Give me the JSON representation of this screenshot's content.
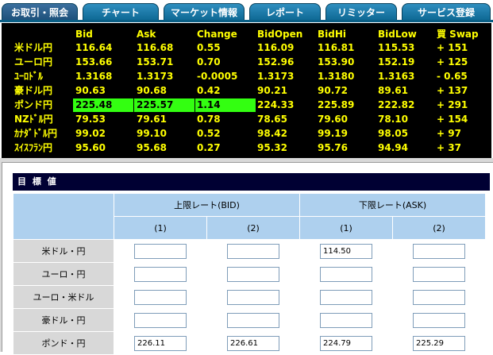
{
  "tabs": [
    {
      "label": "お取引・照会"
    },
    {
      "label": "チャート"
    },
    {
      "label": "マーケット情報"
    },
    {
      "label": "レポート"
    },
    {
      "label": "リミッター"
    },
    {
      "label": "サービス登録"
    }
  ],
  "board": {
    "columns": [
      "Bid",
      "Ask",
      "Change",
      "BidOpen",
      "BidHi",
      "BidLow",
      "買 Swap"
    ],
    "rows": [
      {
        "pair": "米ドル円",
        "bid": "116.64",
        "ask": "116.68",
        "change": "0.55",
        "open": "116.09",
        "hi": "116.81",
        "low": "115.53",
        "swap": "+ 151"
      },
      {
        "pair": "ユーロ円",
        "bid": "153.66",
        "ask": "153.71",
        "change": "0.70",
        "open": "152.96",
        "hi": "153.90",
        "low": "152.19",
        "swap": "+ 125"
      },
      {
        "pair": "ﾕｰﾛﾄﾞﾙ",
        "bid": "1.3168",
        "ask": "1.3173",
        "change": "-0.0005",
        "open": "1.3173",
        "hi": "1.3180",
        "low": "1.3163",
        "swap": "- 0.65"
      },
      {
        "pair": "豪ドル円",
        "bid": "90.63",
        "ask": "90.68",
        "change": "0.42",
        "open": "90.21",
        "hi": "90.72",
        "low": "89.61",
        "swap": "+ 137"
      },
      {
        "pair": "ポンド円",
        "bid": "225.48",
        "ask": "225.57",
        "change": "1.14",
        "open": "224.33",
        "hi": "225.89",
        "low": "222.82",
        "swap": "+ 291"
      },
      {
        "pair": "NZﾄﾞﾙ円",
        "bid": "79.53",
        "ask": "79.61",
        "change": "0.78",
        "open": "78.65",
        "hi": "79.60",
        "low": "78.10",
        "swap": "+ 154"
      },
      {
        "pair": "ｶﾅﾀﾞﾄﾞﾙ円",
        "bid": "99.02",
        "ask": "99.10",
        "change": "0.52",
        "open": "98.42",
        "hi": "99.19",
        "low": "98.05",
        "swap": "+ 97"
      },
      {
        "pair": "ｽｲｽﾌﾗﾝ円",
        "bid": "95.60",
        "ask": "95.68",
        "change": "0.27",
        "open": "95.32",
        "hi": "95.76",
        "low": "94.94",
        "swap": "+ 37"
      }
    ],
    "highlight_row": "ポンド円",
    "highlight_color": "#33ff11",
    "text_color": "#ffff00",
    "background": "#000000"
  },
  "target": {
    "title": "目 標 値",
    "upper_label": "上限レート(BID)",
    "lower_label": "下限レート(ASK)",
    "sub1": "(1)",
    "sub2": "(2)",
    "rows": [
      {
        "label": "米ドル・円",
        "v1": "",
        "v2": "",
        "v3": "114.50",
        "v4": ""
      },
      {
        "label": "ユーロ・円",
        "v1": "",
        "v2": "",
        "v3": "",
        "v4": ""
      },
      {
        "label": "ユーロ・米ドル",
        "v1": "",
        "v2": "",
        "v3": "",
        "v4": ""
      },
      {
        "label": "豪ドル・円",
        "v1": "",
        "v2": "",
        "v3": "",
        "v4": ""
      },
      {
        "label": "ポンド・円",
        "v1": "226.11",
        "v2": "226.61",
        "v3": "224.79",
        "v4": "225.29"
      }
    ]
  }
}
